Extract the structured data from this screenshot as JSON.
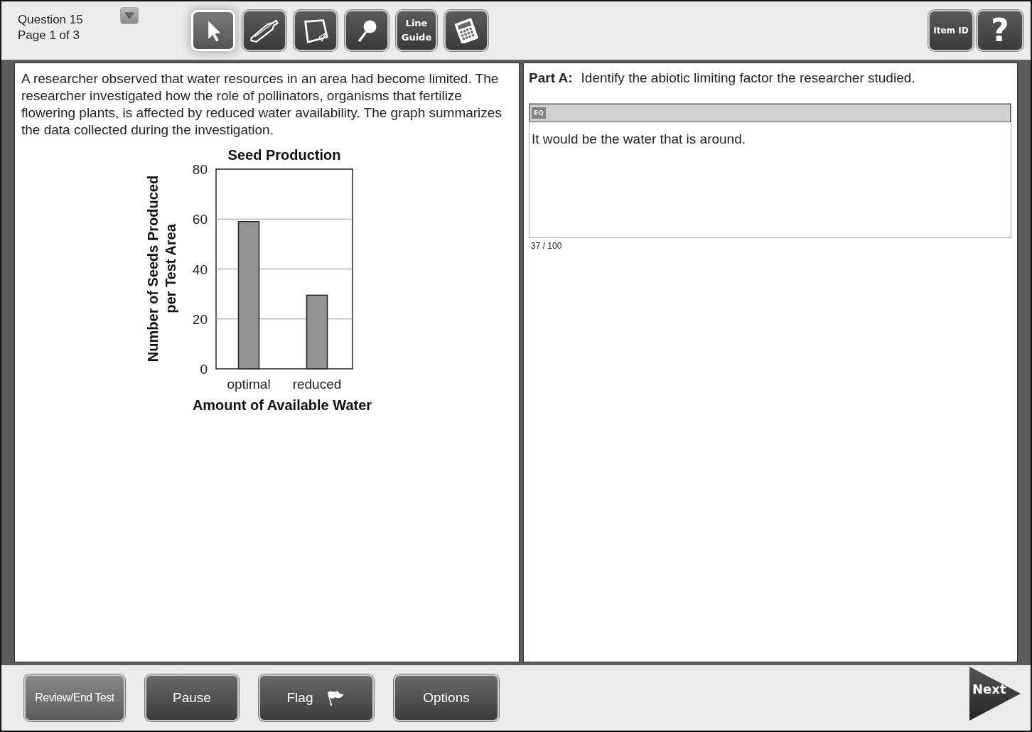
{
  "header": {
    "question": "Question 15",
    "page": "Page 1 of 3"
  },
  "tools": [
    {
      "kind": "pointer",
      "selected": true
    },
    {
      "kind": "highlighter",
      "selected": false
    },
    {
      "kind": "note",
      "selected": false
    },
    {
      "kind": "magnifier",
      "selected": false
    },
    {
      "kind": "text",
      "label": "Line Guide",
      "selected": false
    },
    {
      "kind": "calculator",
      "selected": false
    }
  ],
  "header_buttons": [
    {
      "kind": "text",
      "label": "Item ID"
    },
    {
      "kind": "help",
      "label": "?"
    }
  ],
  "passage": "A researcher observed that water resources in an area had become limited. The researcher investigated how the role of pollinators, organisms that fertilize flowering plants, is affected by reduced water availability. The graph summarizes the data collected during the investigation.",
  "chart_data": {
    "type": "bar",
    "title": "Seed Production",
    "xlabel": "Amount of Available Water",
    "ylabel": "Number of Seeds Produced per Test Area",
    "categories": [
      "optimal",
      "reduced"
    ],
    "values": [
      59,
      29.5
    ],
    "ylim": [
      0,
      80
    ],
    "yticks": [
      0,
      20,
      40,
      60,
      80
    ],
    "grid": true
  },
  "part": {
    "label": "Part A:",
    "prompt": "Identify the abiotic limiting factor the researcher studied."
  },
  "editor": {
    "tool": "EQ",
    "value": "It would be the water that is around.",
    "counter": "37 / 100"
  },
  "footer_buttons": [
    {
      "label": "Review/End Test",
      "icon": false
    },
    {
      "label": "Pause",
      "icon": false
    },
    {
      "label": "Flag",
      "icon": true
    },
    {
      "label": "Options",
      "icon": false
    }
  ],
  "next": "Next"
}
